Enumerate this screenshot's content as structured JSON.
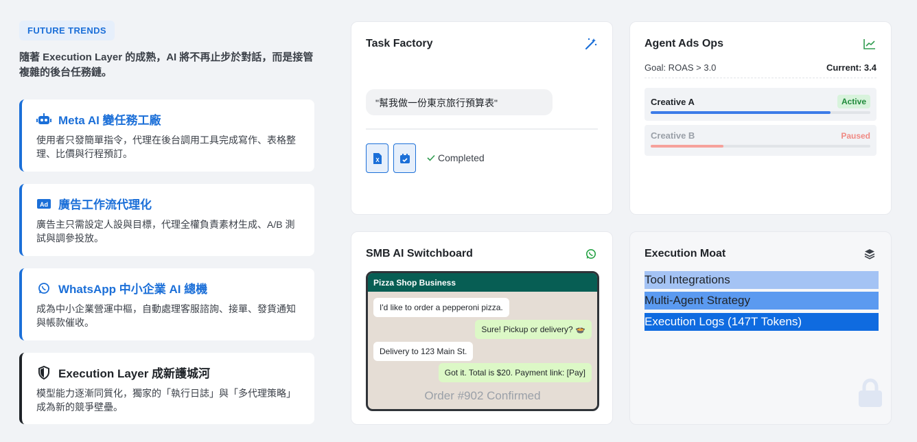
{
  "left": {
    "pill": "FUTURE TRENDS",
    "intro": "隨著 Execution Layer 的成熟，AI 將不再止步於對話，而是接管複雜的後台任務鏈。",
    "items": [
      {
        "title": "Meta AI 變任務工廠",
        "desc": "使用者只發簡單指令，代理在後台調用工具完成寫作、表格整理、比價與行程預訂。",
        "icon": "robot-icon"
      },
      {
        "title": "廣告工作流代理化",
        "desc": "廣告主只需設定人設與目標，代理全權負責素材生成、A/B 測試與調參投放。",
        "icon": "ad-icon"
      },
      {
        "title": "WhatsApp 中小企業 AI 總機",
        "desc": "成為中小企業營運中樞，自動處理客服諮詢、接單、發貨通知與帳款催收。",
        "icon": "whatsapp-icon"
      },
      {
        "title": "Execution Layer 成新護城河",
        "desc": "模型能力逐漸同質化，獨家的「執行日誌」與「多代理策略」成為新的競爭壁壘。",
        "icon": "shield-icon"
      }
    ]
  },
  "task_factory": {
    "title": "Task Factory",
    "prompt": "\"幫我做一份東京旅行預算表\"",
    "status": "Completed",
    "accent": "#1b6fd8"
  },
  "ads_ops": {
    "title": "Agent Ads Ops",
    "goal": "Goal: ROAS > 3.0",
    "current": "Current: 3.4",
    "creatives": [
      {
        "name": "Creative A",
        "status": "Active",
        "progress": 0.82,
        "color": "#3b7be8"
      },
      {
        "name": "Creative B",
        "status": "Paused",
        "progress": 0.33,
        "color": "#f6a19b"
      }
    ]
  },
  "switchboard": {
    "title": "SMB AI Switchboard",
    "chat_title": "Pizza Shop Business",
    "messages": [
      {
        "dir": "in",
        "text": "I'd like to order a pepperoni pizza."
      },
      {
        "dir": "out",
        "text": "Sure! Pickup or delivery? 🍲"
      },
      {
        "dir": "in",
        "text": "Delivery to 123 Main St."
      },
      {
        "dir": "out",
        "text": "Got it. Total is $20. Payment link: [Pay]"
      }
    ],
    "order": "Order #902 Confirmed",
    "brand_color": "#075e54"
  },
  "moat": {
    "title": "Execution Moat",
    "layers": [
      {
        "label": "Tool Integrations",
        "color": "#a4c3f4"
      },
      {
        "label": "Multi-Agent Strategy",
        "color": "#5b9af0"
      },
      {
        "label": "Execution Logs (147T Tokens)",
        "color": "#0f6be0"
      }
    ]
  }
}
